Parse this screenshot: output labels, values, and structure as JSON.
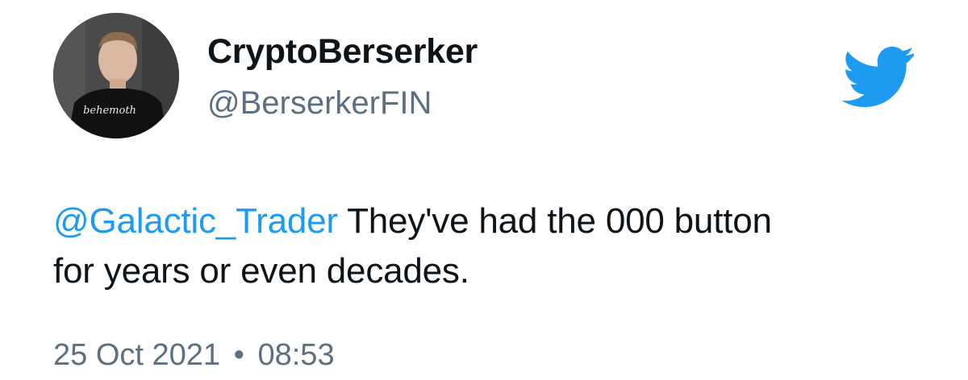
{
  "author": {
    "display_name": "CryptoBerserker",
    "handle": "@BerserkerFIN",
    "avatar_shirt_text": "behemoth"
  },
  "tweet": {
    "mention": "@Galactic_Trader",
    "text_line1": " They've had the 000 button",
    "text_line2": "for years or even decades."
  },
  "meta": {
    "date": "25 Oct 2021",
    "separator": "•",
    "time": "08:53"
  },
  "icons": {
    "brand": "twitter-bird-icon"
  },
  "colors": {
    "mention": "#1d9bf0",
    "secondary_text": "#5b7083",
    "brand_blue": "#1d9bf0",
    "primary_text": "#0f1419"
  }
}
